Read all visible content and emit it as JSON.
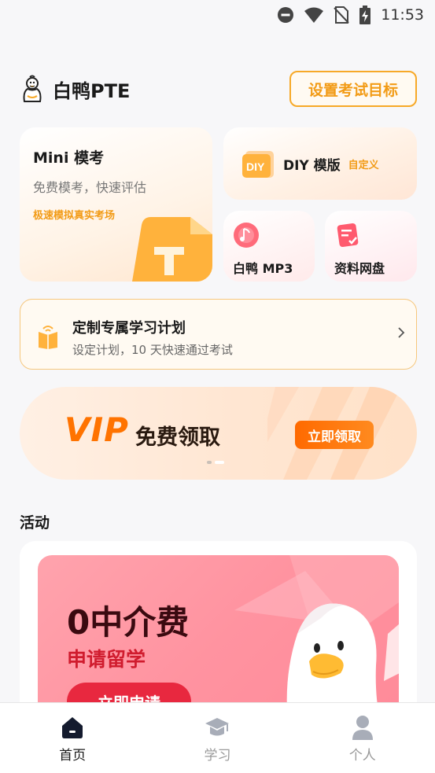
{
  "status_bar": {
    "time": "11:53"
  },
  "header": {
    "brand": "白鸭PTE",
    "goal_button": "设置考试目标"
  },
  "cards": {
    "mini": {
      "title": "Mini 模考",
      "subtitle": "免费模考，快速评估",
      "tag": "极速模拟真实考场"
    },
    "diy": {
      "label": "DIY 模版",
      "tag": "自定义"
    },
    "mp3": {
      "label": "白鸭 MP3"
    },
    "disk": {
      "label": "资料网盘"
    }
  },
  "plan": {
    "title": "定制专属学习计划",
    "subtitle": "设定计划，10 天快速通过考试"
  },
  "vip_banner": {
    "vip": "VIP",
    "free": "免费领取",
    "button": "立即领取"
  },
  "activity": {
    "section_title": "活动",
    "promo_title": "0中介费",
    "promo_subtitle": "申请留学",
    "promo_button": "立即申请"
  },
  "tabbar": {
    "tabs": [
      {
        "label": "首页",
        "icon": "home-icon",
        "active": true
      },
      {
        "label": "学习",
        "icon": "graduation-cap-icon",
        "active": false
      },
      {
        "label": "个人",
        "icon": "person-icon",
        "active": false
      }
    ]
  },
  "colors": {
    "accent": "#f29b16",
    "vip_orange": "#ff7300",
    "promo_red": "#e8283f"
  }
}
